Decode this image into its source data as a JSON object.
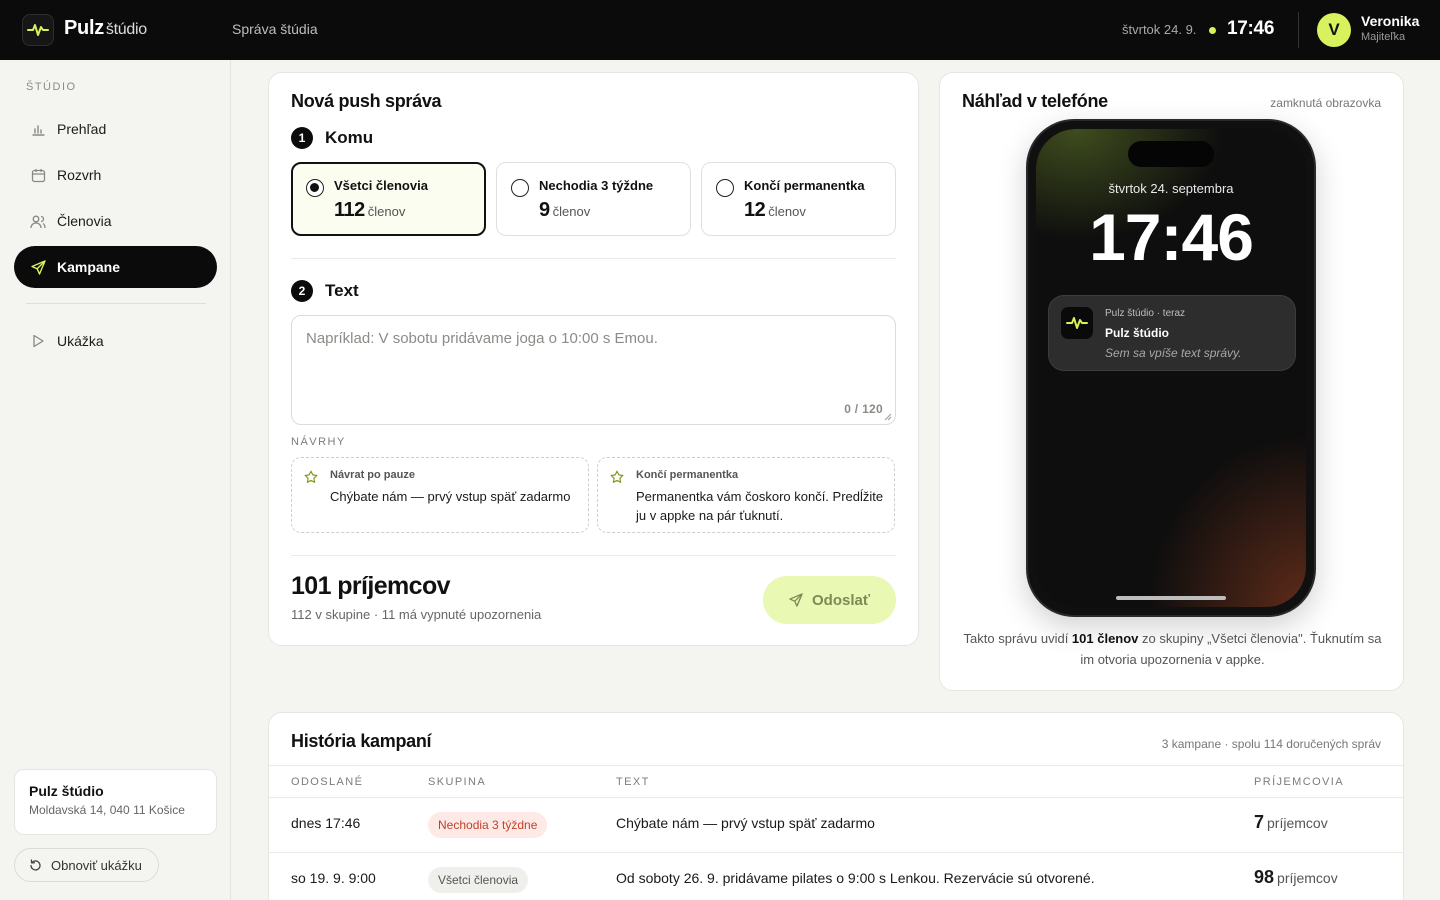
{
  "topbar": {
    "brand": "Pulz",
    "brand_sub": "štúdio",
    "section": "Správa štúdia",
    "date": "štvrtok 24. 9.",
    "time": "17:46",
    "user_initial": "V",
    "user_name": "Veronika",
    "user_role": "Majiteľka"
  },
  "sidebar": {
    "heading": "ŠTÚDIO",
    "items": [
      {
        "label": "Prehľad",
        "icon": "bar-chart-icon"
      },
      {
        "label": "Rozvrh",
        "icon": "calendar-icon"
      },
      {
        "label": "Členovia",
        "icon": "users-icon"
      },
      {
        "label": "Kampane",
        "icon": "send-icon",
        "active": true
      },
      {
        "label": "Ukážka",
        "icon": "play-icon"
      }
    ],
    "studio_name": "Pulz štúdio",
    "studio_address": "Moldavská 14, 040 11 Košice",
    "refresh_label": "Obnoviť ukážku"
  },
  "compose": {
    "title": "Nová push správa",
    "step1_num": "1",
    "step1_label": "Komu",
    "audiences": [
      {
        "name": "Všetci členovia",
        "count": "112",
        "unit": "členov",
        "selected": true
      },
      {
        "name": "Nechodia 3 týždne",
        "count": "9",
        "unit": "členov",
        "selected": false
      },
      {
        "name": "Končí permanentka",
        "count": "12",
        "unit": "členov",
        "selected": false
      }
    ],
    "step2_num": "2",
    "step2_label": "Text",
    "placeholder": "Napríklad: V sobotu pridávame joga o 10:00 s Emou.",
    "char_count": "0 / 120",
    "suggestions_heading": "NÁVRHY",
    "suggestions": [
      {
        "title": "Návrat po pauze",
        "text": "Chýbate nám — prvý vstup späť zadarmo"
      },
      {
        "title": "Končí permanentka",
        "text": "Permanentka vám čoskoro končí. Predĺžite ju v appke na pár ťuknutí."
      }
    ],
    "recipients_big": "101 príjemcov",
    "recipients_detail": "112 v skupine · 11 má vypnuté upozornenia",
    "send_label": "Odoslať"
  },
  "preview": {
    "title": "Náhľad v telefóne",
    "hint": "zamknutá obrazovka",
    "lock_date": "štvrtok 24. septembra",
    "lock_time": "17:46",
    "notif_meta": "Pulz štúdio · teraz",
    "notif_title": "Pulz štúdio",
    "notif_body": "Sem sa vpíše text správy.",
    "caption_pre": "Takto správu uvidí ",
    "caption_bold": "101 členov",
    "caption_post": " zo skupiny „Všetci členovia\". Ťuknutím sa im otvoria upozornenia v appke."
  },
  "history": {
    "title": "História kampaní",
    "meta": "3 kampane · spolu 114 doručených správ",
    "columns": [
      "ODOSLANÉ",
      "SKUPINA",
      "TEXT",
      "PRÍJEMCOVIA"
    ],
    "rows": [
      {
        "when": "dnes 17:46",
        "group": "Nechodia 3 týždne",
        "group_style": "warn",
        "text": "Chýbate nám — prvý vstup späť zadarmo",
        "recipients": "7",
        "unit": "príjemcov"
      },
      {
        "when": "so 19. 9. 9:00",
        "group": "Všetci členovia",
        "group_style": "neutral",
        "text": "Od soboty 26. 9. pridávame pilates o 9:00 s Lenkou. Rezervácie sú otvorené.",
        "recipients": "98",
        "unit": "príjemcov"
      }
    ]
  },
  "colors": {
    "accent": "#d7f25c",
    "dark": "#0b0b0b",
    "warn_badge": "#c2412a"
  }
}
